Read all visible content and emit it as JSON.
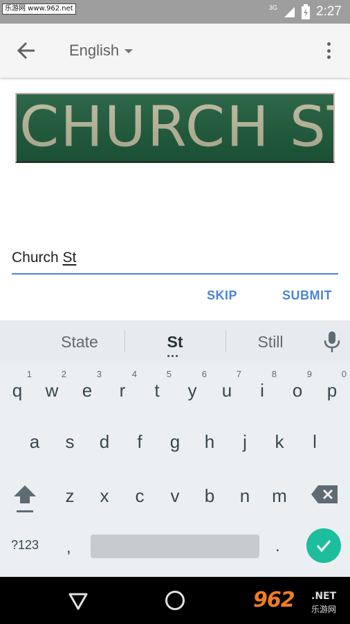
{
  "status_bar": {
    "watermark_text": "乐游网 www.962.net",
    "network": "3G",
    "time": "2:27",
    "icons": [
      "signal-icon",
      "battery-icon"
    ]
  },
  "app_bar": {
    "back_icon": "arrow-left-icon",
    "language": "English",
    "more_icon": "more-vert-icon"
  },
  "image": {
    "sign_text": "CHURCH ST",
    "sign_color": "#1d5a3a"
  },
  "input": {
    "value_plain": "Church ",
    "value_underlined": "St"
  },
  "actions": {
    "skip": "SKIP",
    "submit": "SUBMIT",
    "accent": "#4a86d8"
  },
  "keyboard": {
    "suggestions": [
      "State",
      "St",
      "Still"
    ],
    "row1": [
      {
        "key": "q",
        "hint": "1"
      },
      {
        "key": "w",
        "hint": "2"
      },
      {
        "key": "e",
        "hint": "3"
      },
      {
        "key": "r",
        "hint": "4"
      },
      {
        "key": "t",
        "hint": "5"
      },
      {
        "key": "y",
        "hint": "6"
      },
      {
        "key": "u",
        "hint": "7"
      },
      {
        "key": "i",
        "hint": "8"
      },
      {
        "key": "o",
        "hint": "9"
      },
      {
        "key": "p",
        "hint": "0"
      }
    ],
    "row2": [
      "a",
      "s",
      "d",
      "f",
      "g",
      "h",
      "j",
      "k",
      "l"
    ],
    "row3": [
      "z",
      "x",
      "c",
      "v",
      "b",
      "n",
      "m"
    ],
    "symbols": "?123",
    "comma": ",",
    "period": ".",
    "enter_color": "#1dbe9e"
  },
  "nav_bar": {
    "watermark_big": "962",
    "watermark_net": ".NET",
    "watermark_cn": "乐游网"
  }
}
